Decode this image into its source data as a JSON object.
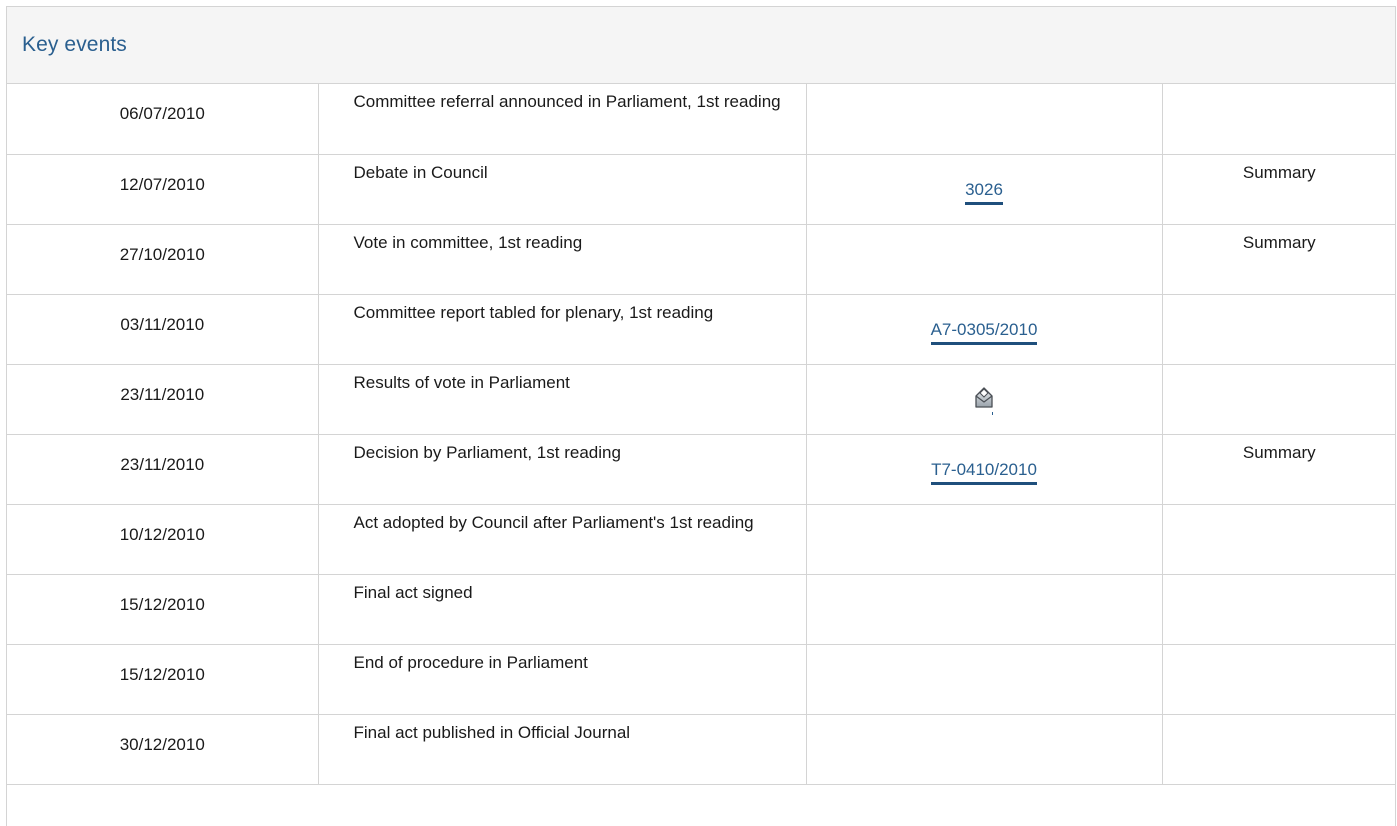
{
  "panel": {
    "title": "Key events"
  },
  "events": [
    {
      "date": "06/07/2010",
      "description": "Committee referral announced in Parliament, 1st reading",
      "document": "",
      "summary": ""
    },
    {
      "date": "12/07/2010",
      "description": "Debate in Council",
      "document": "3026",
      "summary": "Summary"
    },
    {
      "date": "27/10/2010",
      "description": "Vote in committee, 1st reading",
      "document": "",
      "summary": "Summary"
    },
    {
      "date": "03/11/2010",
      "description": "Committee report tabled for plenary, 1st reading",
      "document": "A7-0305/2010",
      "summary": ""
    },
    {
      "date": "23/11/2010",
      "description": "Results of vote in Parliament",
      "document": "",
      "document_icon": "ballot-box-icon",
      "summary": ""
    },
    {
      "date": "23/11/2010",
      "description": "Decision by Parliament, 1st reading",
      "document": "T7-0410/2010",
      "summary": "Summary"
    },
    {
      "date": "10/12/2010",
      "description": "Act adopted by Council after Parliament's 1st reading",
      "document": "",
      "summary": ""
    },
    {
      "date": "15/12/2010",
      "description": "Final act signed",
      "document": "",
      "summary": ""
    },
    {
      "date": "15/12/2010",
      "description": "End of procedure in Parliament",
      "document": "",
      "summary": ""
    },
    {
      "date": "30/12/2010",
      "description": "Final act published in Official Journal",
      "document": "",
      "summary": ""
    }
  ],
  "colors": {
    "link": "#2a5f8f",
    "link_underline": "#1f4f7c",
    "border": "#d4d4d4",
    "header_bg": "#f5f5f5"
  }
}
